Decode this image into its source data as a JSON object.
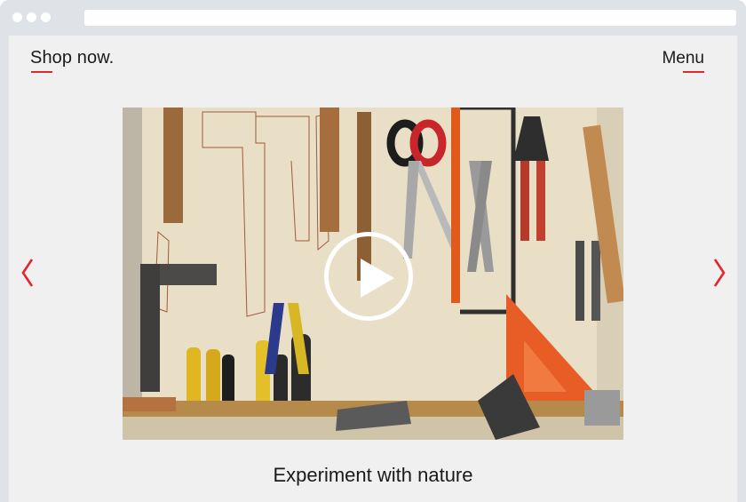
{
  "header": {
    "brand": "Shop now.",
    "menu_label": "Menu"
  },
  "slide": {
    "caption": "Experiment with nature",
    "image_icon": "tool-wall-photo",
    "play_icon": "play-icon"
  },
  "nav": {
    "prev_icon": "chevron-left-icon",
    "next_icon": "chevron-right-icon"
  },
  "colors": {
    "accent": "#e1262c",
    "page_bg": "#f0f0f0",
    "chrome": "#dfe2e6",
    "text": "#1a1a1a"
  }
}
